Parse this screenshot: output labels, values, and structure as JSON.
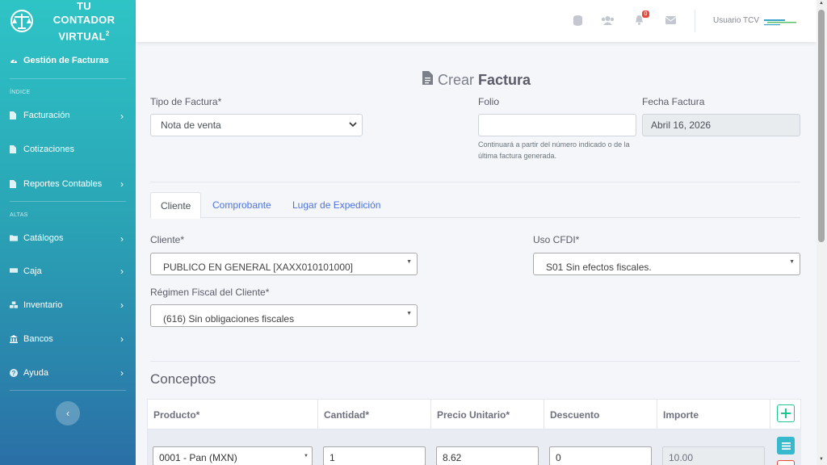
{
  "brand": {
    "line1": "TU",
    "line2": "CONTADOR",
    "line3": "VIRTUAL",
    "sup": "2"
  },
  "sidebar": {
    "active": "Gestión de Facturas",
    "section_indice": "ÍNDICE",
    "section_altas": "ALTAS",
    "items": [
      {
        "label": "Facturación",
        "icon": "file-icon",
        "chevron": true
      },
      {
        "label": "Cotizaciones",
        "icon": "file-icon",
        "chevron": false
      },
      {
        "label": "Reportes Contables",
        "icon": "file-icon",
        "chevron": true
      },
      {
        "label": "Catálogos",
        "icon": "folder-icon",
        "chevron": true
      },
      {
        "label": "Caja",
        "icon": "money-icon",
        "chevron": true
      },
      {
        "label": "Inventario",
        "icon": "boxes-icon",
        "chevron": true
      },
      {
        "label": "Bancos",
        "icon": "bank-icon",
        "chevron": true
      },
      {
        "label": "Ayuda",
        "icon": "question-icon",
        "chevron": true
      }
    ],
    "collapse_glyph": "‹",
    "chevron_glyph": "›"
  },
  "topbar": {
    "notification_count": "0",
    "user_name": "Usuario TCV"
  },
  "page": {
    "title_light": "Crear",
    "title_bold": "Factura"
  },
  "form": {
    "tipo_label": "Tipo de Factura*",
    "tipo_value": "Nota de venta",
    "folio_label": "Folio",
    "folio_value": "",
    "folio_hint": "Continuará a partir del número indicado o de la última factura generada.",
    "fecha_label": "Fecha Factura",
    "fecha_value": "Abril 16, 2026"
  },
  "tabs": [
    "Cliente",
    "Comprobante",
    "Lugar de Expedición"
  ],
  "cliente": {
    "cliente_label": "Cliente*",
    "cliente_value": "PUBLICO EN GENERAL [XAXX010101000]",
    "uso_label": "Uso CFDI*",
    "uso_value": "S01 Sin efectos fiscales.",
    "regimen_label": "Régimen Fiscal del Cliente*",
    "regimen_value": "(616) Sin obligaciones fiscales"
  },
  "conceptos": {
    "title": "Conceptos",
    "headers": [
      "Producto*",
      "Cantidad*",
      "Precio Unitario*",
      "Descuento",
      "Importe"
    ],
    "row": {
      "producto": "0001 - Pan (MXN)",
      "cantidad": "1",
      "precio": "8.62",
      "descuento": "0",
      "importe": "10.00"
    }
  },
  "colors": {
    "accent": "#4e73df",
    "success": "#1cc88a",
    "info": "#36b9cc",
    "danger": "#e74a3b"
  }
}
